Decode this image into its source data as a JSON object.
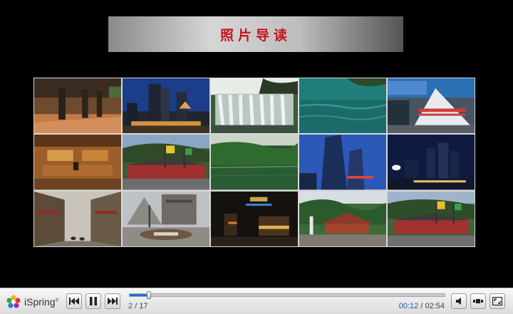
{
  "slide": {
    "title": "照片导读",
    "photos": [
      {
        "name": "photo-bronze-statues"
      },
      {
        "name": "photo-city-night-towers"
      },
      {
        "name": "photo-waterfall"
      },
      {
        "name": "photo-lake-water"
      },
      {
        "name": "photo-stone-monument"
      },
      {
        "name": "photo-office-lobby"
      },
      {
        "name": "photo-temple-flags"
      },
      {
        "name": "photo-green-lake"
      },
      {
        "name": "photo-skyscraper-dusk"
      },
      {
        "name": "photo-city-night-lights"
      },
      {
        "name": "photo-old-street"
      },
      {
        "name": "photo-square-trees"
      },
      {
        "name": "photo-night-market"
      },
      {
        "name": "photo-mountain-temple"
      },
      {
        "name": "photo-temple-flags-2"
      }
    ]
  },
  "player": {
    "brand": "iSpring",
    "current_slide": "2",
    "separator": "/",
    "total_slides": "17",
    "elapsed": "00:12",
    "time_separator": "/",
    "duration": "02:54",
    "progress_fraction": 0.06,
    "accent_color": "#1f6fd0",
    "icons": {
      "prev": "rewind-icon",
      "pause": "pause-icon",
      "next": "forward-icon",
      "volume": "speaker-icon",
      "layout": "layout-icon",
      "fullscreen": "fullscreen-icon"
    }
  }
}
